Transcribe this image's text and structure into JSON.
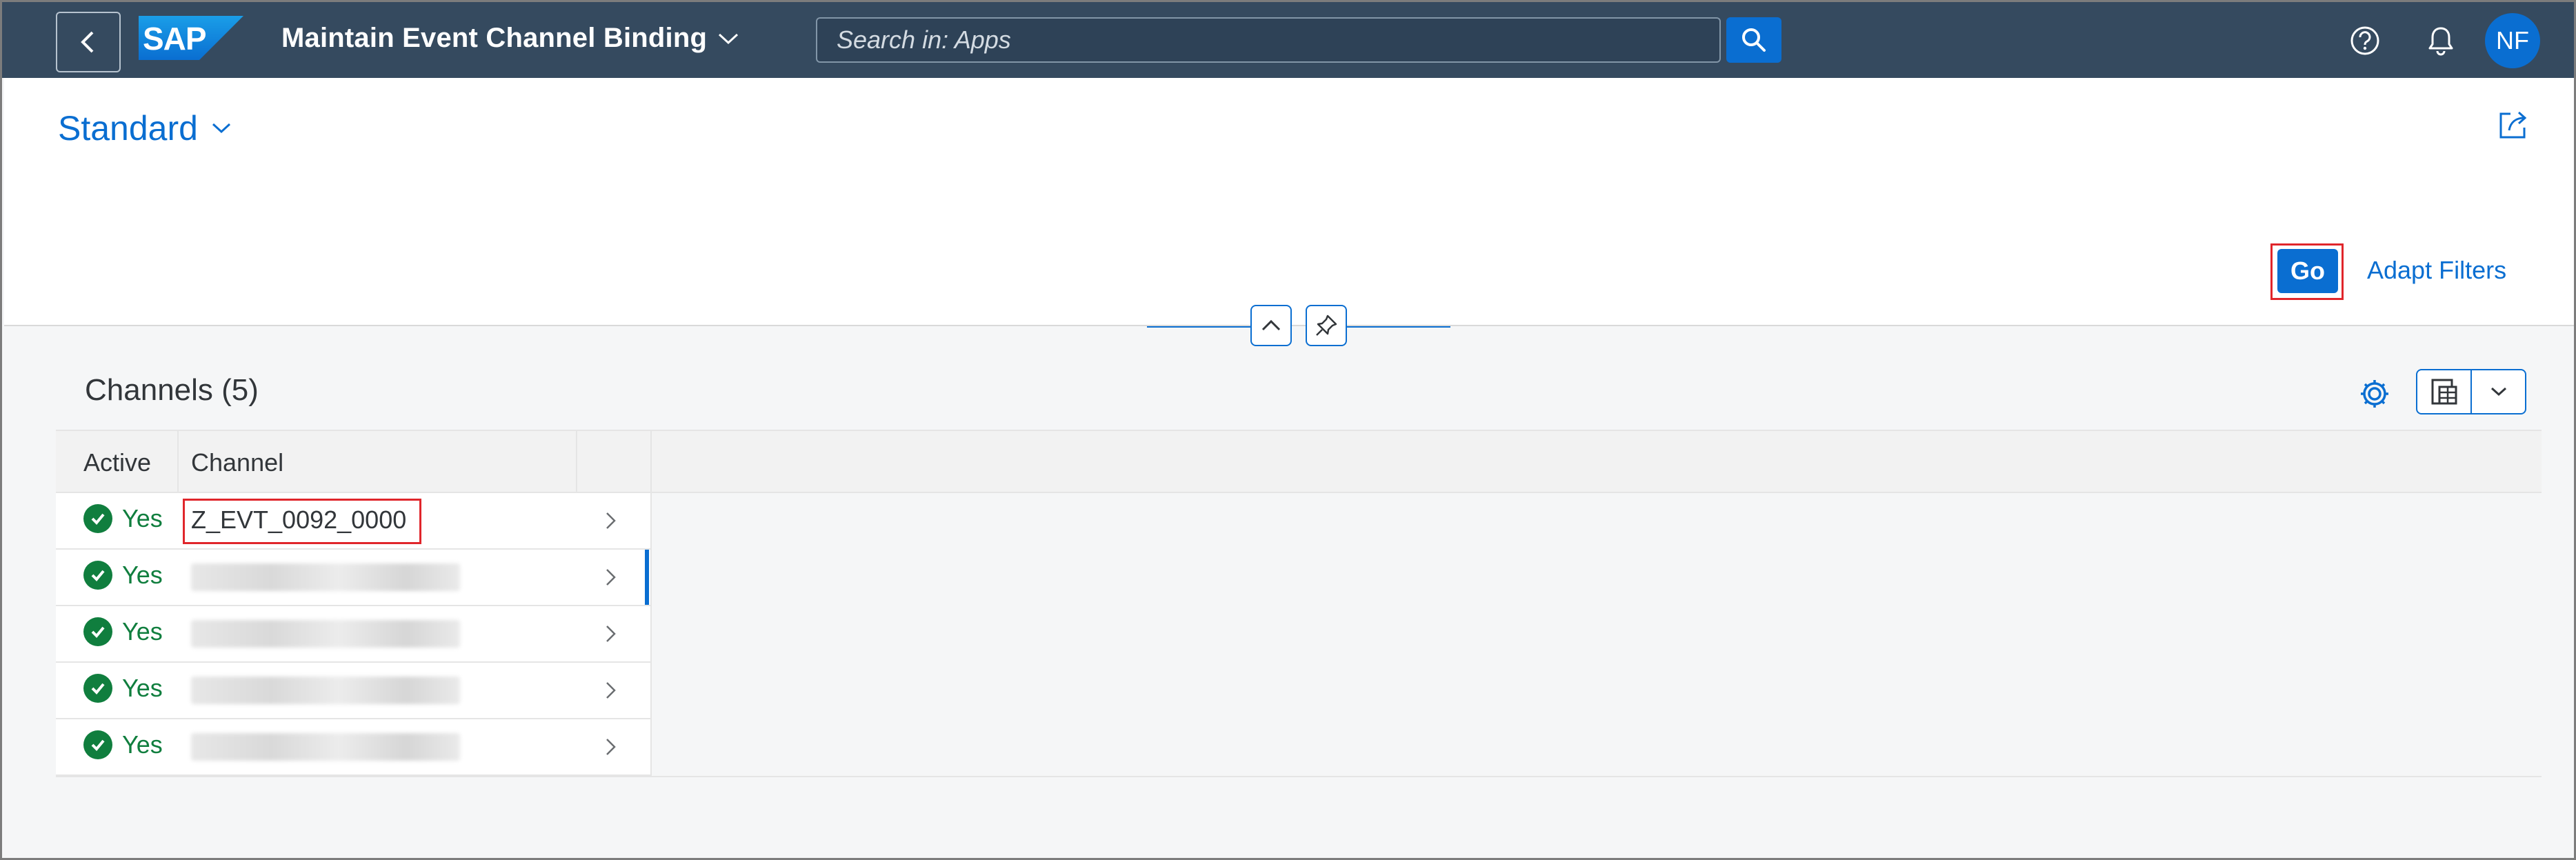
{
  "shell": {
    "logo_text": "SAP",
    "app_title": "Maintain Event Channel Binding",
    "search_placeholder": "Search in: Apps",
    "user_initials": "NF"
  },
  "filter_bar": {
    "variant_name": "Standard",
    "go_label": "Go",
    "adapt_filters_label": "Adapt Filters"
  },
  "table": {
    "title": "Channels (5)",
    "columns": [
      "Active",
      "Channel"
    ],
    "rows": [
      {
        "active": "Yes",
        "channel": "Z_EVT_0092_0000"
      },
      {
        "active": "Yes",
        "channel": ""
      },
      {
        "active": "Yes",
        "channel": ""
      },
      {
        "active": "Yes",
        "channel": ""
      },
      {
        "active": "Yes",
        "channel": ""
      }
    ]
  },
  "colors": {
    "shell_bg": "#354a5f",
    "accent": "#0a6ed1",
    "positive": "#107e3e",
    "highlight": "#e0262b"
  }
}
